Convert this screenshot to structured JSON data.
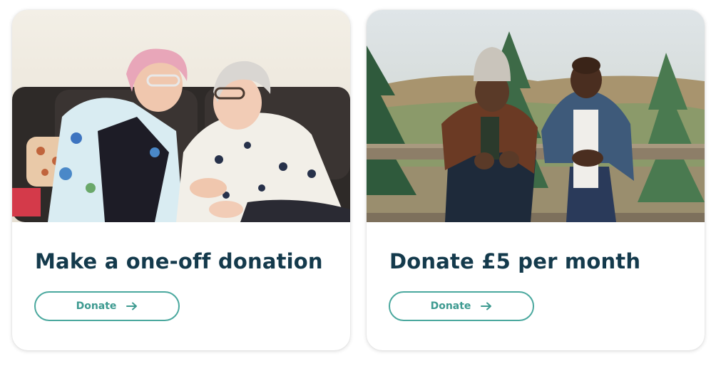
{
  "cards": [
    {
      "title": "Make a one-off donation",
      "button_label": "Donate",
      "button_icon": "arrow-right-icon",
      "image": "two-older-women-laughing-on-sofa"
    },
    {
      "title": "Donate £5 per month",
      "button_label": "Donate",
      "button_icon": "arrow-right-icon",
      "image": "two-men-leaning-on-fence-in-tree-farm"
    }
  ],
  "colors": {
    "title": "#143a4c",
    "button_border": "#4aa89e",
    "button_text": "#3d9a90"
  }
}
